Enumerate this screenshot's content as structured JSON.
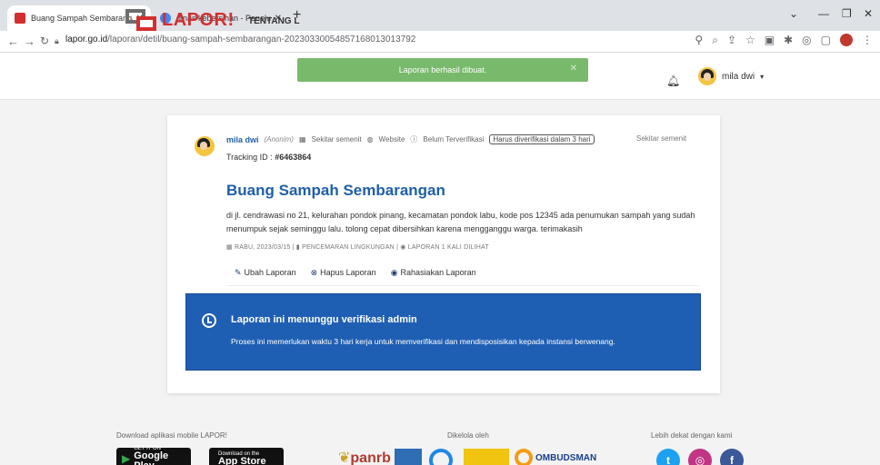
{
  "browser": {
    "tabs": [
      {
        "title": "Buang Sampah Sembarangan - L",
        "favicon_color": "#d32f2f"
      },
      {
        "title": "dinas kebersihan - Penelusuran G",
        "favicon_color": "#4285f4"
      }
    ],
    "url_host": "lapor.go.id",
    "url_path": "/laporan/detil/buang-sampah-sembarangan-20230330054857168013013792"
  },
  "header": {
    "logo_text": "LAPOR!",
    "menu_tentang": "TENTANG L",
    "toast": "Laporan berhasil dibuat.",
    "user_name": "mila dwi"
  },
  "report": {
    "author": "mila dwi",
    "anon": "(Anonim)",
    "location_meta": "Sekitar semenit",
    "channel": "Website",
    "status": "Belum Terverifikasi",
    "deadline_badge": "Harus diverifikasi dalam 3 hari",
    "location_right": "Sekitar semenit",
    "tracking_label": "Tracking ID : ",
    "tracking_id": "#6463864",
    "title": "Buang Sampah Sembarangan",
    "description": "di jl. cendrawasi no 21, kelurahan pondok pinang, kecamatan pondok labu, kode pos 12345 ada penumukan sampah yang sudah menumpuk sejak seminggu lalu. tolong cepat dibersihkan karena mengganggu warga. terimakasih",
    "info_date": "RABU, 2023/03/15",
    "info_category": "PENCEMARAN LINGKUNGAN",
    "info_views": "LAPORAN 1 KALI DILIHAT",
    "actions": {
      "edit": "Ubah Laporan",
      "delete": "Hapus Laporan",
      "hide": "Rahasiakan Laporan"
    }
  },
  "verify": {
    "title": "Laporan ini menunggu verifikasi admin",
    "desc": "Proses ini memerlukan waktu 3 hari kerja untuk memverifikasi dan mendisposisikan kepada instansi berwenang."
  },
  "footer": {
    "download_label": "Download aplikasi mobile LAPOR!",
    "google_small": "GET IT ON",
    "google_big": "Google Play",
    "apple_small": "Download on the",
    "apple_big": "App Store",
    "managed_label": "Dikelola oleh",
    "panrb": "panrb",
    "ombudsman": "OMBUDSMAN",
    "social_label": "Lebih dekat dengan kami"
  },
  "colors": {
    "brand_red": "#d32f2f",
    "link_blue": "#1f5fa8",
    "verify_blue": "#1f5fb3",
    "toast_green": "#78b96b"
  }
}
